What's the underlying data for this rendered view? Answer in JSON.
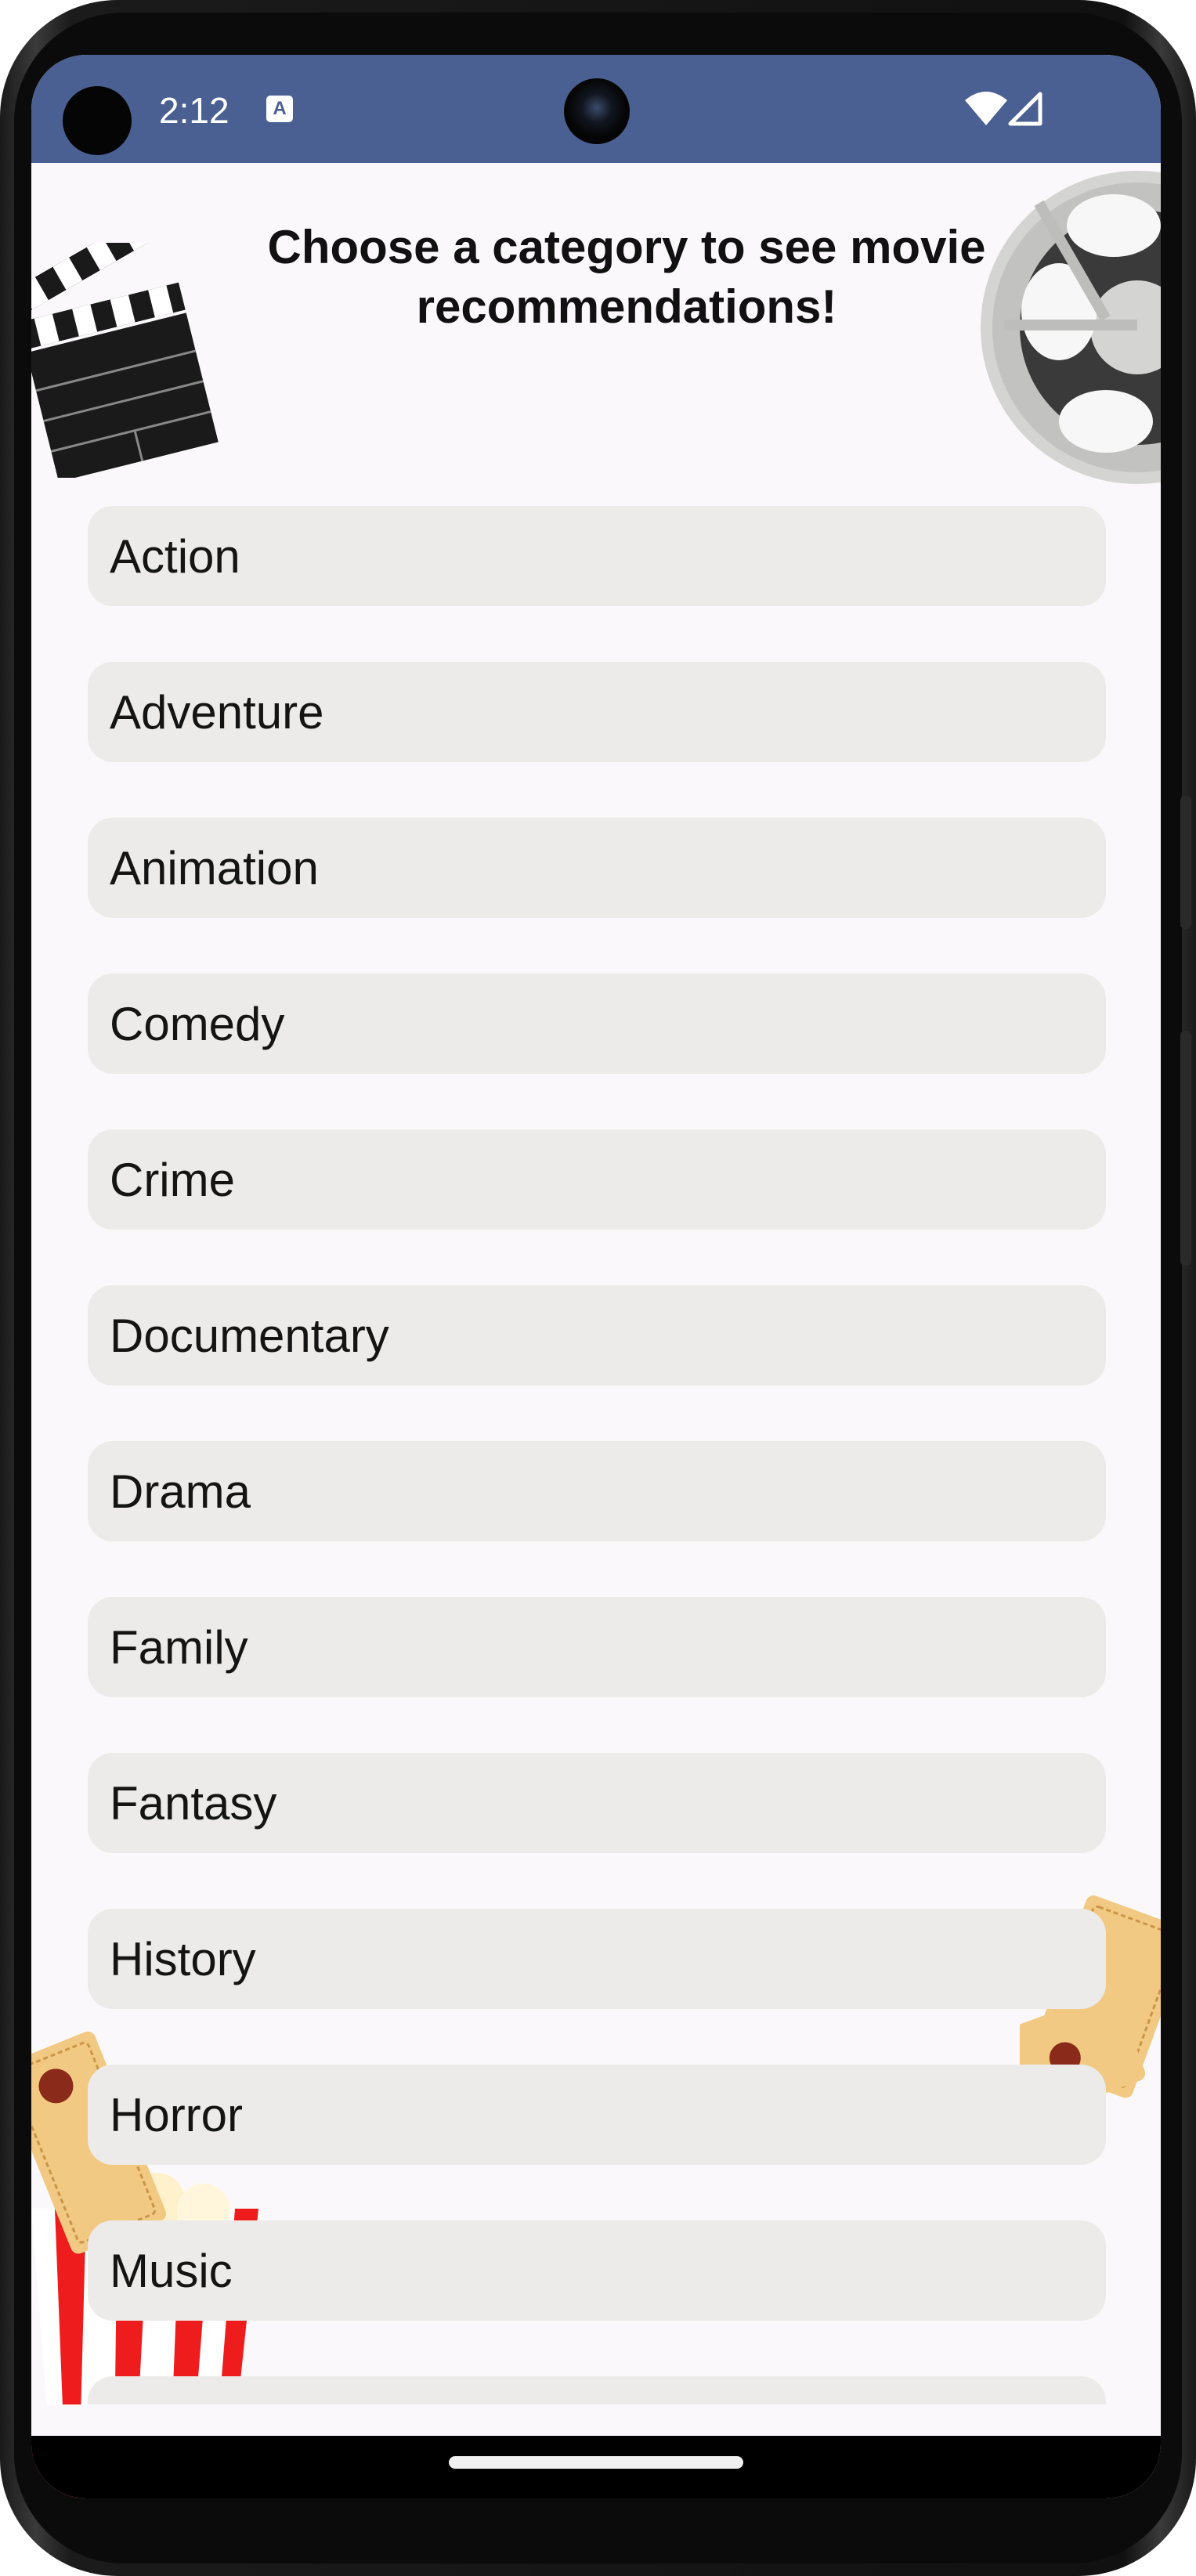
{
  "status_bar": {
    "time": "2:12",
    "notification_icon": "A",
    "icons": [
      "wifi-icon",
      "cell-signal-icon"
    ]
  },
  "header": {
    "title": "Choose a category to see movie recommendations!"
  },
  "categories": [
    "Action",
    "Adventure",
    "Animation",
    "Comedy",
    "Crime",
    "Documentary",
    "Drama",
    "Family",
    "Fantasy",
    "History",
    "Horror",
    "Music",
    ""
  ],
  "colors": {
    "status_bar": "#4a5f92",
    "background": "#fbf8fb",
    "button_bg": "#ecebe9",
    "text": "#141414"
  }
}
